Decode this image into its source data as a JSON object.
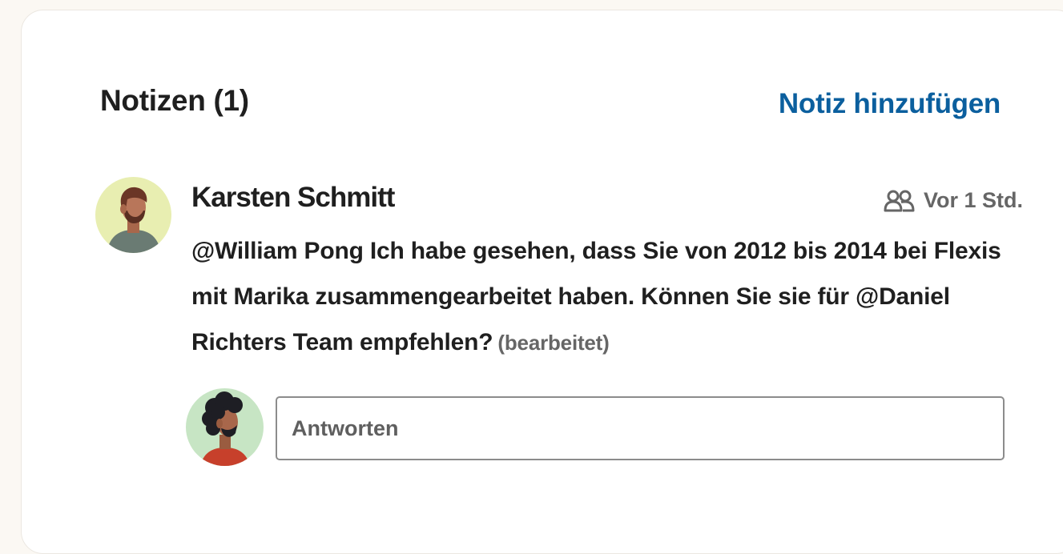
{
  "notes": {
    "title": "Notizen (1)",
    "add_label": "Notiz hinzufügen",
    "items": [
      {
        "author": "Karsten Schmitt",
        "visibility_icon": "group-icon",
        "time": "Vor 1 Std.",
        "text": "@William Pong Ich habe gesehen, dass Sie von 2012 bis 2014 bei Flexis mit Marika zusammengearbeitet haben. Können Sie sie für @Daniel Richters Team empfehlen?",
        "edited_label": "(bearbeitet)"
      }
    ],
    "reply": {
      "placeholder": "Antworten",
      "value": ""
    }
  },
  "colors": {
    "link": "#0b5f9e",
    "text": "#1f1f1f",
    "muted": "#666666",
    "author_avatar_bg": "#e8eeb1",
    "reply_avatar_bg": "#c7e5c4"
  }
}
